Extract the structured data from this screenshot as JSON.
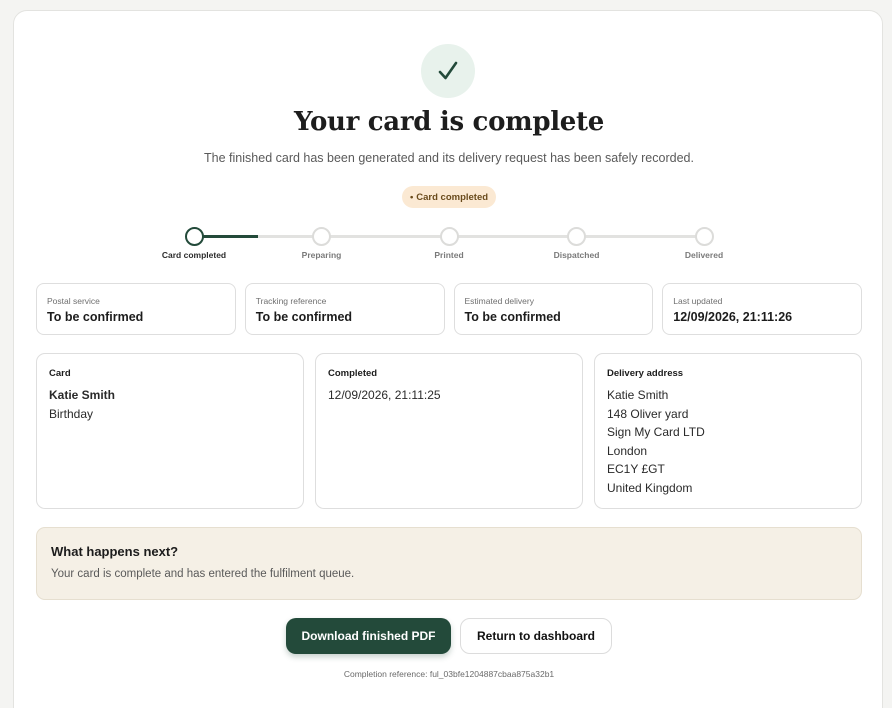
{
  "header": {
    "check_icon": "check-icon",
    "title": "Your card is complete",
    "subtitle": "The finished card has been generated and its delivery request has been safely recorded.",
    "badge": "Card completed",
    "badge_dot": "•"
  },
  "progress": {
    "completed_fraction": 0.125,
    "steps": [
      {
        "label": "Card completed",
        "state": "current"
      },
      {
        "label": "Preparing",
        "state": "pending"
      },
      {
        "label": "Printed",
        "state": "pending"
      },
      {
        "label": "Dispatched",
        "state": "pending"
      },
      {
        "label": "Delivered",
        "state": "pending"
      }
    ]
  },
  "info": [
    {
      "label": "Postal service",
      "value": "To be confirmed"
    },
    {
      "label": "Tracking reference",
      "value": "To be confirmed"
    },
    {
      "label": "Estimated delivery",
      "value": "To be confirmed"
    },
    {
      "label": "Last updated",
      "value": "12/09/2026, 21:11:26"
    }
  ],
  "details": {
    "card": {
      "label": "Card",
      "name": "Katie Smith",
      "occasion": "Birthday"
    },
    "completed": {
      "label": "Completed",
      "value": "12/09/2026, 21:11:25"
    },
    "address": {
      "label": "Delivery address",
      "lines": [
        "Katie Smith",
        "148 Oliver yard",
        "Sign My Card LTD",
        "London",
        "EC1Y £GT",
        "United Kingdom"
      ]
    }
  },
  "next": {
    "heading": "What happens next?",
    "text": "Your card is complete and has entered the fulfilment queue."
  },
  "actions": {
    "download_label": "Download finished PDF",
    "dashboard_label": "Return to dashboard"
  },
  "reference": "Completion reference: ful_03bfe1204887cbaa875a32b1",
  "colors": {
    "brand": "#234a3a",
    "badge_bg": "#fbe9d3",
    "next_bg": "#f5f0e6"
  }
}
